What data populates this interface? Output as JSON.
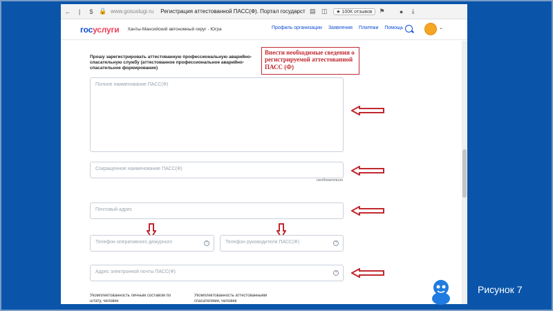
{
  "browser": {
    "url": "www.gosuslugi.ru",
    "tab_title": "Регистрация аттестованной ПАСС(Ф). Портал государственных услуг...",
    "reviews_badge": "★ 100К отзывов"
  },
  "header": {
    "logo_part1": "гос",
    "logo_part2": "услуги",
    "region": "Ханты-Мансийский автономный округ - Югра",
    "nav": [
      "Профиль организации",
      "Заявления",
      "Платежи",
      "Помощь"
    ]
  },
  "form": {
    "intro": "Прошу зарегистрировать аттестованную профессиональную аварийно-спасательную службу (аттестованное профессиональное аварийно-спасательное формирование)",
    "annotation": "Внести необходимые сведения о регистрируемой аттестованной ПАСС (Ф)",
    "full_name_placeholder": "Полное наименование ПАСС(Ф)",
    "short_name_placeholder": "Сокращенное наименование ПАСС(Ф)",
    "optional_hint": "необязательно",
    "address_placeholder": "Почтовый адрес",
    "duty_phone_placeholder": "Телефон оперативного дежурного",
    "head_phone_placeholder": "Телефон руководителя ПАСС(Ф)",
    "email_placeholder": "Адрес электронной почты ПАСС(Ф)",
    "staff_label": "Укомплектованность личным составом по штату, человек",
    "rescuers_label": "Укомплектованность аттестованными спасателями, человек"
  },
  "slide": {
    "caption": "Рисунок 7",
    "accent_color": "#0a55aa",
    "arrow_color": "#c0282e"
  }
}
